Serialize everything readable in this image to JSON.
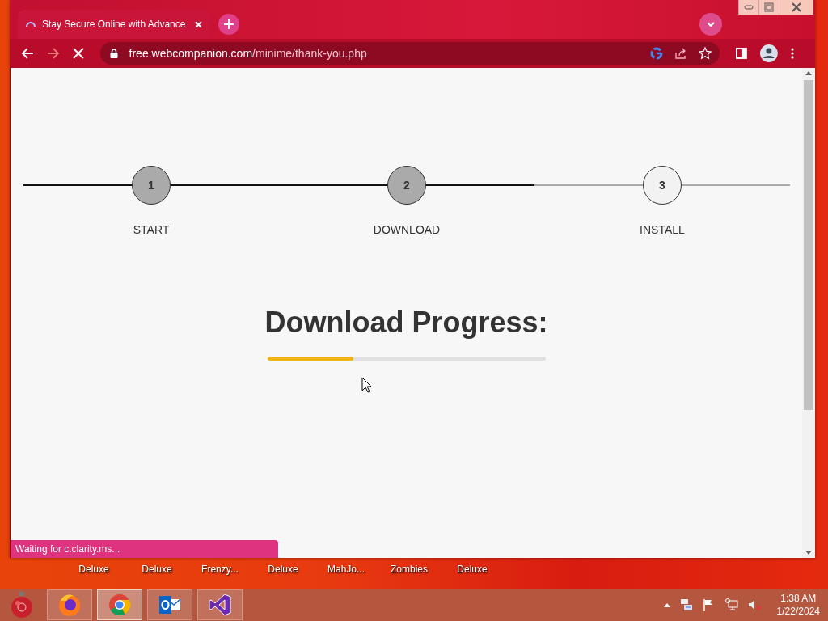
{
  "browser": {
    "tab": {
      "title": "Stay Secure Online with Advance",
      "loading": true
    },
    "url": {
      "host": "free.webcompanion.com",
      "path": "/minime/thank-you.php"
    }
  },
  "steps": {
    "level": 0.667,
    "items": [
      {
        "number": "1",
        "label": "START",
        "done": true
      },
      {
        "number": "2",
        "label": "DOWNLOAD",
        "done": true
      },
      {
        "number": "3",
        "label": "INSTALL",
        "done": false
      }
    ]
  },
  "progress": {
    "title": "Download Progress:",
    "level": 0.31
  },
  "status": "Waiting for c.clarity.ms...",
  "desktop_icons": [
    {
      "label": "Deluxe"
    },
    {
      "label": "Deluxe"
    },
    {
      "label": "Frenzy..."
    },
    {
      "label": "Deluxe"
    },
    {
      "label": "MahJo..."
    },
    {
      "label": "Zombies"
    },
    {
      "label": "Deluxe"
    }
  ],
  "taskbar": {
    "apps": [
      {
        "kind": "firefox",
        "selected": false
      },
      {
        "kind": "chrome",
        "selected": true
      },
      {
        "kind": "outlook",
        "selected": false
      },
      {
        "kind": "studio",
        "selected": false
      }
    ],
    "time": "1:38 AM",
    "date": "1/22/2024"
  }
}
